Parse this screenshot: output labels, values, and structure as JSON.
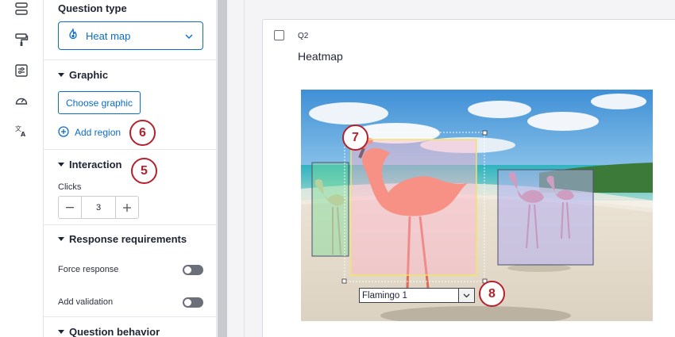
{
  "rail": {
    "icons": [
      "survey-flow-icon",
      "paint-roller-icon",
      "options-icon",
      "speedometer-icon",
      "translate-icon"
    ]
  },
  "panel": {
    "question_type_heading": "Question type",
    "question_type_value": "Heat map",
    "graphic_heading": "Graphic",
    "choose_graphic_label": "Choose graphic",
    "add_region_label": "Add region",
    "interaction_heading": "Interaction",
    "clicks_label": "Clicks",
    "clicks_value": "3",
    "response_requirements_heading": "Response requirements",
    "force_response_label": "Force response",
    "add_validation_label": "Add validation",
    "question_behavior_heading": "Question behavior"
  },
  "callouts": {
    "five": "5",
    "six": "6",
    "seven": "7",
    "eight": "8"
  },
  "question": {
    "number": "Q2",
    "text": "Heatmap",
    "region_dropdown_value": "Flamingo 1"
  },
  "colors": {
    "accent": "#0b6cc9",
    "callout": "#b5202d",
    "region_selected_border": "#f2e36a"
  }
}
